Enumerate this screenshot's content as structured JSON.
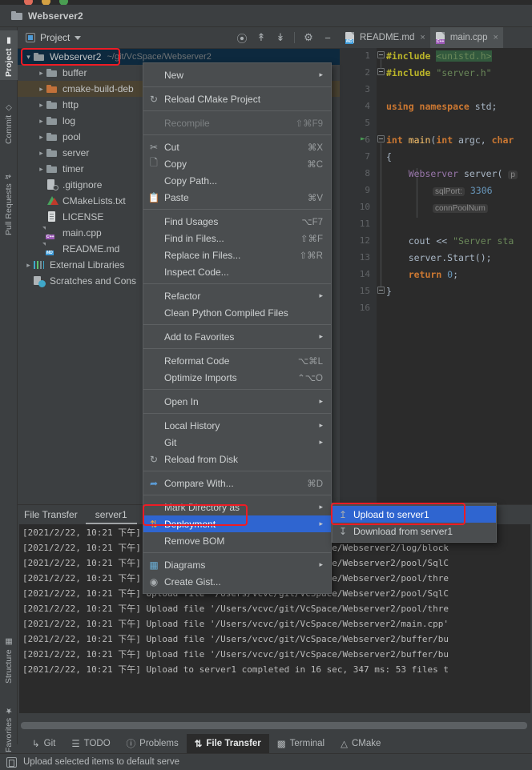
{
  "window": {
    "title": "Webserver2",
    "traffic_lights": [
      "close",
      "minimize",
      "zoom"
    ]
  },
  "left_tool_strip": {
    "top_tabs": [
      {
        "label": "Project",
        "icon": "folder-icon",
        "selected": true
      },
      {
        "label": "Commit",
        "icon": "commit-icon",
        "selected": false
      },
      {
        "label": "Pull Requests",
        "icon": "pull-request-icon",
        "selected": false
      }
    ],
    "bottom_tabs": [
      {
        "label": "Structure",
        "icon": "structure-icon",
        "selected": false
      },
      {
        "label": "Favorites",
        "icon": "star-icon",
        "selected": false
      }
    ]
  },
  "project_panel": {
    "title": "Project",
    "toolbar_icons": [
      "locate-icon",
      "expand-all-icon",
      "collapse-all-icon",
      "gear-icon",
      "hide-icon"
    ],
    "tree": [
      {
        "label": "Webserver2",
        "hint": "~/git/VcSpace/Webserver2",
        "icon": "folder-icon",
        "arrow": "expanded",
        "indent": 0,
        "state": "selected"
      },
      {
        "label": "buffer",
        "icon": "folder-icon",
        "arrow": "collapsed",
        "indent": 1,
        "state": "normal"
      },
      {
        "label": "cmake-build-deb",
        "icon": "folder-orange-icon",
        "arrow": "collapsed",
        "indent": 1,
        "state": "hover"
      },
      {
        "label": "http",
        "icon": "folder-icon",
        "arrow": "collapsed",
        "indent": 1,
        "state": "normal"
      },
      {
        "label": "log",
        "icon": "folder-icon",
        "arrow": "collapsed",
        "indent": 1,
        "state": "normal"
      },
      {
        "label": "pool",
        "icon": "folder-icon",
        "arrow": "collapsed",
        "indent": 1,
        "state": "normal"
      },
      {
        "label": "server",
        "icon": "folder-icon",
        "arrow": "collapsed",
        "indent": 1,
        "state": "normal"
      },
      {
        "label": "timer",
        "icon": "folder-icon",
        "arrow": "collapsed",
        "indent": 1,
        "state": "normal"
      },
      {
        "label": ".gitignore",
        "icon": "gitignore-file-icon",
        "arrow": "none",
        "indent": 1,
        "state": "normal"
      },
      {
        "label": "CMakeLists.txt",
        "icon": "cmake-file-icon",
        "arrow": "none",
        "indent": 1,
        "state": "normal"
      },
      {
        "label": "LICENSE",
        "icon": "text-file-icon",
        "arrow": "none",
        "indent": 1,
        "state": "normal"
      },
      {
        "label": "main.cpp",
        "icon": "cpp-file-icon",
        "arrow": "none",
        "indent": 1,
        "state": "normal"
      },
      {
        "label": "README.md",
        "icon": "markdown-file-icon",
        "arrow": "none",
        "indent": 1,
        "state": "normal"
      },
      {
        "label": "External Libraries",
        "icon": "library-icon",
        "arrow": "collapsed",
        "indent": 0,
        "state": "normal"
      },
      {
        "label": "Scratches and Cons",
        "icon": "scratches-icon",
        "arrow": "none",
        "indent": 0,
        "state": "normal"
      }
    ]
  },
  "context_menu": {
    "items": [
      {
        "label": "New",
        "icon": "",
        "shortcut": "",
        "arrow": true,
        "disabled": false,
        "sep_after": true
      },
      {
        "label": "Reload CMake Project",
        "icon": "refresh-icon",
        "shortcut": "",
        "arrow": false,
        "disabled": false,
        "sep_after": true
      },
      {
        "label": "Recompile",
        "icon": "",
        "shortcut": "⇧⌘F9",
        "arrow": false,
        "disabled": true,
        "sep_after": true
      },
      {
        "label": "Cut",
        "icon": "scissors-icon",
        "shortcut": "⌘X",
        "arrow": false,
        "disabled": false,
        "sep_after": false
      },
      {
        "label": "Copy",
        "icon": "copy-icon",
        "shortcut": "⌘C",
        "arrow": false,
        "disabled": false,
        "sep_after": false
      },
      {
        "label": "Copy Path...",
        "icon": "",
        "shortcut": "",
        "arrow": false,
        "disabled": false,
        "sep_after": false
      },
      {
        "label": "Paste",
        "icon": "clipboard-icon",
        "shortcut": "⌘V",
        "arrow": false,
        "disabled": false,
        "sep_after": true
      },
      {
        "label": "Find Usages",
        "icon": "",
        "shortcut": "⌥F7",
        "arrow": false,
        "disabled": false,
        "sep_after": false
      },
      {
        "label": "Find in Files...",
        "icon": "",
        "shortcut": "⇧⌘F",
        "arrow": false,
        "disabled": false,
        "sep_after": false
      },
      {
        "label": "Replace in Files...",
        "icon": "",
        "shortcut": "⇧⌘R",
        "arrow": false,
        "disabled": false,
        "sep_after": false
      },
      {
        "label": "Inspect Code...",
        "icon": "",
        "shortcut": "",
        "arrow": false,
        "disabled": false,
        "sep_after": true
      },
      {
        "label": "Refactor",
        "icon": "",
        "shortcut": "",
        "arrow": true,
        "disabled": false,
        "sep_after": false
      },
      {
        "label": "Clean Python Compiled Files",
        "icon": "",
        "shortcut": "",
        "arrow": false,
        "disabled": false,
        "sep_after": true
      },
      {
        "label": "Add to Favorites",
        "icon": "",
        "shortcut": "",
        "arrow": true,
        "disabled": false,
        "sep_after": true
      },
      {
        "label": "Reformat Code",
        "icon": "",
        "shortcut": "⌥⌘L",
        "arrow": false,
        "disabled": false,
        "sep_after": false
      },
      {
        "label": "Optimize Imports",
        "icon": "",
        "shortcut": "⌃⌥O",
        "arrow": false,
        "disabled": false,
        "sep_after": true
      },
      {
        "label": "Open In",
        "icon": "",
        "shortcut": "",
        "arrow": true,
        "disabled": false,
        "sep_after": true
      },
      {
        "label": "Local History",
        "icon": "",
        "shortcut": "",
        "arrow": true,
        "disabled": false,
        "sep_after": false
      },
      {
        "label": "Git",
        "icon": "",
        "shortcut": "",
        "arrow": true,
        "disabled": false,
        "sep_after": false
      },
      {
        "label": "Reload from Disk",
        "icon": "refresh-icon",
        "shortcut": "",
        "arrow": false,
        "disabled": false,
        "sep_after": true
      },
      {
        "label": "Compare With...",
        "icon": "compare-icon",
        "shortcut": "⌘D",
        "arrow": false,
        "disabled": false,
        "sep_after": true
      },
      {
        "label": "Mark Directory as",
        "icon": "",
        "shortcut": "",
        "arrow": true,
        "disabled": false,
        "sep_after": false
      },
      {
        "label": "Deployment",
        "icon": "deployment-icon",
        "shortcut": "",
        "arrow": true,
        "disabled": false,
        "highlighted": true,
        "sep_after": false
      },
      {
        "label": "Remove BOM",
        "icon": "",
        "shortcut": "",
        "arrow": false,
        "disabled": false,
        "sep_after": true
      },
      {
        "label": "Diagrams",
        "icon": "diagram-icon",
        "shortcut": "",
        "arrow": true,
        "disabled": false,
        "sep_after": false
      },
      {
        "label": "Create Gist...",
        "icon": "github-icon",
        "shortcut": "",
        "arrow": false,
        "disabled": false,
        "sep_after": false
      }
    ]
  },
  "submenu": {
    "items": [
      {
        "label": "Upload to server1",
        "icon": "upload-icon",
        "highlighted": true
      },
      {
        "label": "Download from server1",
        "icon": "download-icon",
        "highlighted": false
      }
    ]
  },
  "editor": {
    "tabs": [
      {
        "label": "README.md",
        "icon": "markdown-file-icon",
        "badge": "MD",
        "active": false,
        "close": "×"
      },
      {
        "label": "main.cpp",
        "icon": "cpp-file-icon",
        "badge": "C++",
        "active": true,
        "close": "×"
      }
    ],
    "line_numbers": [
      "1",
      "2",
      "3",
      "4",
      "5",
      "6",
      "7",
      "8",
      "9",
      "10",
      "11",
      "12",
      "13",
      "14",
      "15",
      "16"
    ],
    "code_lines": [
      "#include <unistd.h>",
      "#include \"server.h\"",
      "",
      "using namespace std;",
      "",
      "int main(int argc, char",
      "{",
      "    Webserver server( p",
      "        sqlPort: 3306",
      "        connPoolNum",
      "",
      "    cout << \"Server sta",
      "    server.Start();",
      "    return 0;",
      "}",
      ""
    ],
    "hints": {
      "sql_port_label": "sqlPort:",
      "sql_port_value": "3306",
      "conn_pool_label": "connPoolNum"
    }
  },
  "file_transfer": {
    "panel_label": "File Transfer",
    "server_tab": "server1",
    "log_lines": [
      "[2021/2/22, 10:21 下午] Upload file '/Users/vcvc/git/VcSpace/Webserver2/log/Log.h'",
      "[2021/2/22, 10:21 下午] Upload file '/Users/vcvc/git/VcSpace/Webserver2/log/block",
      "[2021/2/22, 10:21 下午] Upload file '/Users/vcvc/git/VcSpace/Webserver2/pool/SqlC",
      "[2021/2/22, 10:21 下午] Upload file '/Users/vcvc/git/VcSpace/Webserver2/pool/thre",
      "[2021/2/22, 10:21 下午] Upload file '/Users/vcvc/git/VcSpace/Webserver2/pool/SqlC",
      "[2021/2/22, 10:21 下午] Upload file '/Users/vcvc/git/VcSpace/Webserver2/pool/thre",
      "[2021/2/22, 10:21 下午] Upload file '/Users/vcvc/git/VcSpace/Webserver2/main.cpp'",
      "[2021/2/22, 10:21 下午] Upload file '/Users/vcvc/git/VcSpace/Webserver2/buffer/bu",
      "[2021/2/22, 10:21 下午] Upload file '/Users/vcvc/git/VcSpace/Webserver2/buffer/bu",
      "[2021/2/22, 10:21 下午] Upload to server1 completed in 16 sec, 347 ms: 53 files t"
    ]
  },
  "bottom_tabs": [
    {
      "label": "Git",
      "icon": "git-icon",
      "active": false
    },
    {
      "label": "TODO",
      "icon": "todo-icon",
      "active": false
    },
    {
      "label": "Problems",
      "icon": "problems-icon",
      "active": false
    },
    {
      "label": "File Transfer",
      "icon": "transfer-icon",
      "active": true
    },
    {
      "label": "Terminal",
      "icon": "terminal-icon",
      "active": false
    },
    {
      "label": "CMake",
      "icon": "cmake-icon",
      "active": false
    }
  ],
  "status_bar": {
    "icon": "window-icon",
    "message": "Upload selected items to default serve"
  },
  "colors": {
    "accent_blue": "#2f65d0",
    "annotation_red": "#ee1c25",
    "panel_bg": "#3c3f41",
    "editor_bg": "#2b2b2b",
    "selection_tree": "#0d293e"
  }
}
